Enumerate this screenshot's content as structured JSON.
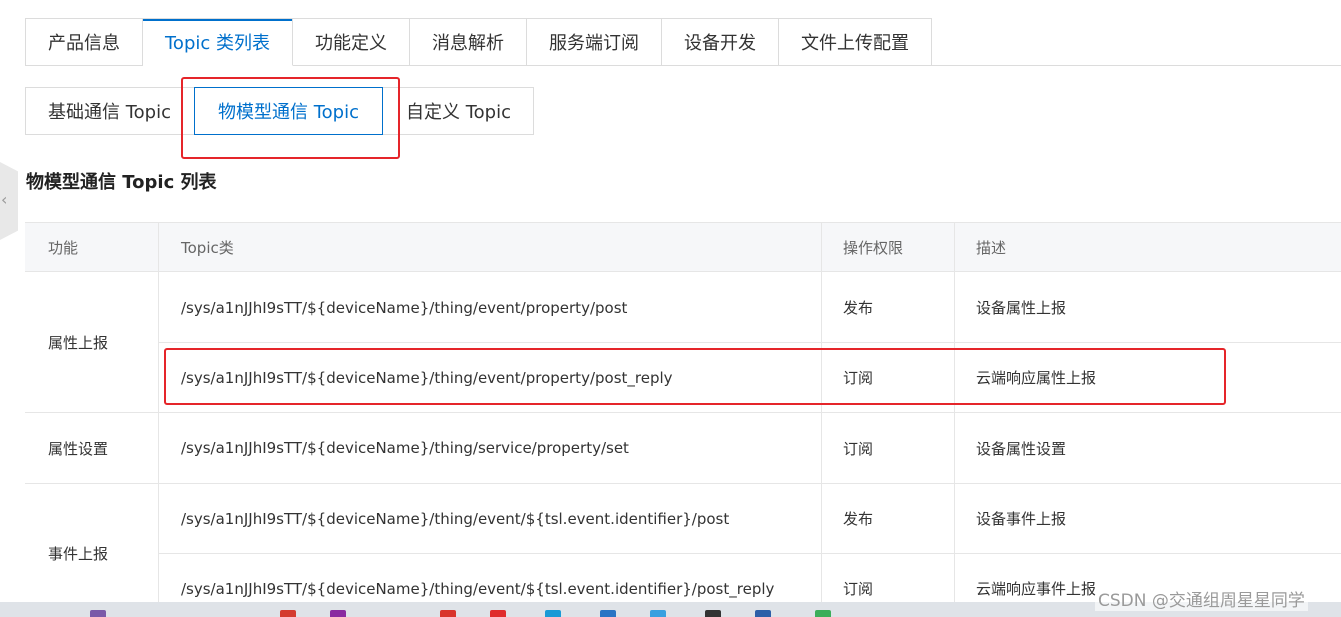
{
  "top_tabs": [
    "产品信息",
    "Topic 类列表",
    "功能定义",
    "消息解析",
    "服务端订阅",
    "设备开发",
    "文件上传配置"
  ],
  "active_top_tab": "Topic 类列表",
  "sub_tabs": [
    "基础通信 Topic",
    "物模型通信 Topic",
    "自定义 Topic"
  ],
  "active_sub_tab": "物模型通信 Topic",
  "section_title": "物模型通信 Topic 列表",
  "table": {
    "headers": [
      "功能",
      "Topic类",
      "操作权限",
      "描述"
    ],
    "groups": [
      {
        "function": "属性上报",
        "rows": [
          {
            "topic": "/sys/a1nJJhI9sTT/${deviceName}/thing/event/property/post",
            "permission": "发布",
            "desc": "设备属性上报"
          },
          {
            "topic": "/sys/a1nJJhI9sTT/${deviceName}/thing/event/property/post_reply",
            "permission": "订阅",
            "desc": "云端响应属性上报"
          }
        ]
      },
      {
        "function": "属性设置",
        "rows": [
          {
            "topic": "/sys/a1nJJhI9sTT/${deviceName}/thing/service/property/set",
            "permission": "订阅",
            "desc": "设备属性设置"
          }
        ]
      },
      {
        "function": "事件上报",
        "rows": [
          {
            "topic": "/sys/a1nJJhI9sTT/${deviceName}/thing/event/${tsl.event.identifier}/post",
            "permission": "发布",
            "desc": "设备事件上报"
          },
          {
            "topic": "/sys/a1nJJhI9sTT/${deviceName}/thing/event/${tsl.event.identifier}/post_reply",
            "permission": "订阅",
            "desc": "云端响应事件上报"
          }
        ]
      }
    ]
  },
  "watermark": "CSDN @交通组周星星同学",
  "colors": {
    "accent": "#0070cc",
    "highlight": "#e5252a",
    "header_bg": "#f6f7f9"
  },
  "icons": {
    "collapse_handle": "chevron-left-icon"
  }
}
